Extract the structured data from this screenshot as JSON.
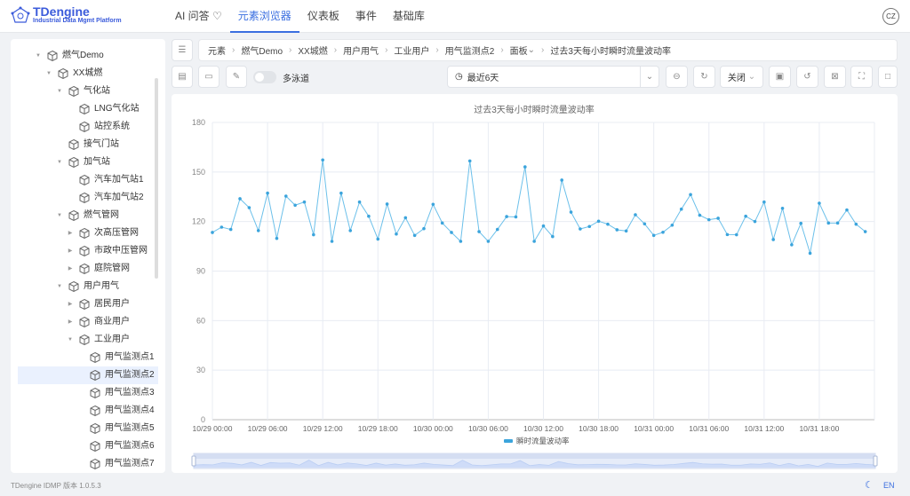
{
  "app": {
    "logo_title": "TDengine",
    "logo_subtitle": "Industrial Data Mgmt Platform",
    "avatar": "CZ",
    "version": "TDengine IDMP 版本 1.0.5.3",
    "lang": "EN"
  },
  "nav": [
    {
      "label": "AI 问答"
    },
    {
      "label": "元素浏览器",
      "active": true
    },
    {
      "label": "仪表板"
    },
    {
      "label": "事件"
    },
    {
      "label": "基础库"
    }
  ],
  "tree": [
    {
      "label": "燃气Demo",
      "level": 0,
      "caret": "down"
    },
    {
      "label": "XX城燃",
      "level": 1,
      "caret": "down"
    },
    {
      "label": "气化站",
      "level": 2,
      "caret": "down"
    },
    {
      "label": "LNG气化站",
      "level": 3,
      "caret": ""
    },
    {
      "label": "站控系统",
      "level": 3,
      "caret": ""
    },
    {
      "label": "接气门站",
      "level": 2,
      "caret": ""
    },
    {
      "label": "加气站",
      "level": 2,
      "caret": "down"
    },
    {
      "label": "汽车加气站1",
      "level": 3,
      "caret": ""
    },
    {
      "label": "汽车加气站2",
      "level": 3,
      "caret": ""
    },
    {
      "label": "燃气管网",
      "level": 2,
      "caret": "down"
    },
    {
      "label": "次高压管网",
      "level": 3,
      "caret": "right"
    },
    {
      "label": "市政中压管网",
      "level": 3,
      "caret": "right"
    },
    {
      "label": "庭院管网",
      "level": 3,
      "caret": "right"
    },
    {
      "label": "用户用气",
      "level": 2,
      "caret": "down"
    },
    {
      "label": "居民用户",
      "level": 3,
      "caret": "right"
    },
    {
      "label": "商业用户",
      "level": 3,
      "caret": "right"
    },
    {
      "label": "工业用户",
      "level": 3,
      "caret": "down"
    },
    {
      "label": "用气监测点1",
      "level": 4,
      "caret": ""
    },
    {
      "label": "用气监测点2",
      "level": 4,
      "caret": "",
      "selected": true
    },
    {
      "label": "用气监测点3",
      "level": 4,
      "caret": ""
    },
    {
      "label": "用气监测点4",
      "level": 4,
      "caret": ""
    },
    {
      "label": "用气监测点5",
      "level": 4,
      "caret": ""
    },
    {
      "label": "用气监测点6",
      "level": 4,
      "caret": ""
    },
    {
      "label": "用气监测点7",
      "level": 4,
      "caret": ""
    }
  ],
  "breadcrumb": [
    "元素",
    "燃气Demo",
    "XX城燃",
    "用户用气",
    "工业用户",
    "用气监测点2",
    "面板",
    "过去3天每小时瞬时流量波动率"
  ],
  "toolbar": {
    "multi_lane_label": "多泳道",
    "multi_lane_on": false,
    "time_range": "最近6天",
    "refresh_option": "关闭"
  },
  "colors": {
    "accent": "#3b6fe0",
    "series": "#3ba4dc"
  },
  "chart_data": {
    "type": "line",
    "title": "过去3天每小时瞬时流量波动率",
    "legend": [
      "瞬时流量波动率"
    ],
    "legend_position": "bottom-center",
    "x_start": "10/29 00:00",
    "x_step_hours": 1,
    "xlim_hours": [
      0,
      72
    ],
    "x_ticks": [
      "10/29 00:00",
      "10/29 06:00",
      "10/29 12:00",
      "10/29 18:00",
      "10/30 00:00",
      "10/30 06:00",
      "10/30 12:00",
      "10/30 18:00",
      "10/31 00:00",
      "10/31 06:00",
      "10/31 12:00",
      "10/31 18:00"
    ],
    "y_ticks": [
      "0",
      "30",
      "60",
      "90",
      "120",
      "150",
      "180"
    ],
    "ylim": [
      0,
      180
    ],
    "grid": true,
    "series": [
      {
        "name": "瞬时流量波动率",
        "values": [
          113.4,
          116.6,
          115.2,
          133.8,
          128.4,
          114.5,
          137.2,
          109.8,
          135.4,
          129.9,
          131.8,
          112,
          157.3,
          108,
          137.2,
          114.5,
          131.8,
          123.2,
          109.4,
          130.6,
          112.4,
          122.3,
          111.6,
          115.7,
          130.4,
          119.1,
          113.4,
          108,
          156.7,
          113.9,
          108,
          115.2,
          123,
          122.8,
          153.1,
          108,
          117.3,
          110.9,
          145.1,
          125.7,
          115.5,
          117,
          120.2,
          118.4,
          115,
          114.3,
          124.1,
          118.6,
          111.6,
          113.5,
          117.8,
          127.5,
          136.3,
          123.8,
          121.1,
          122,
          112.1,
          112,
          123.2,
          120,
          131.8,
          109.1,
          128,
          105.9,
          118.9,
          100.8,
          131.1,
          119.1,
          119.1,
          127,
          118.4,
          113.9
        ]
      }
    ]
  }
}
